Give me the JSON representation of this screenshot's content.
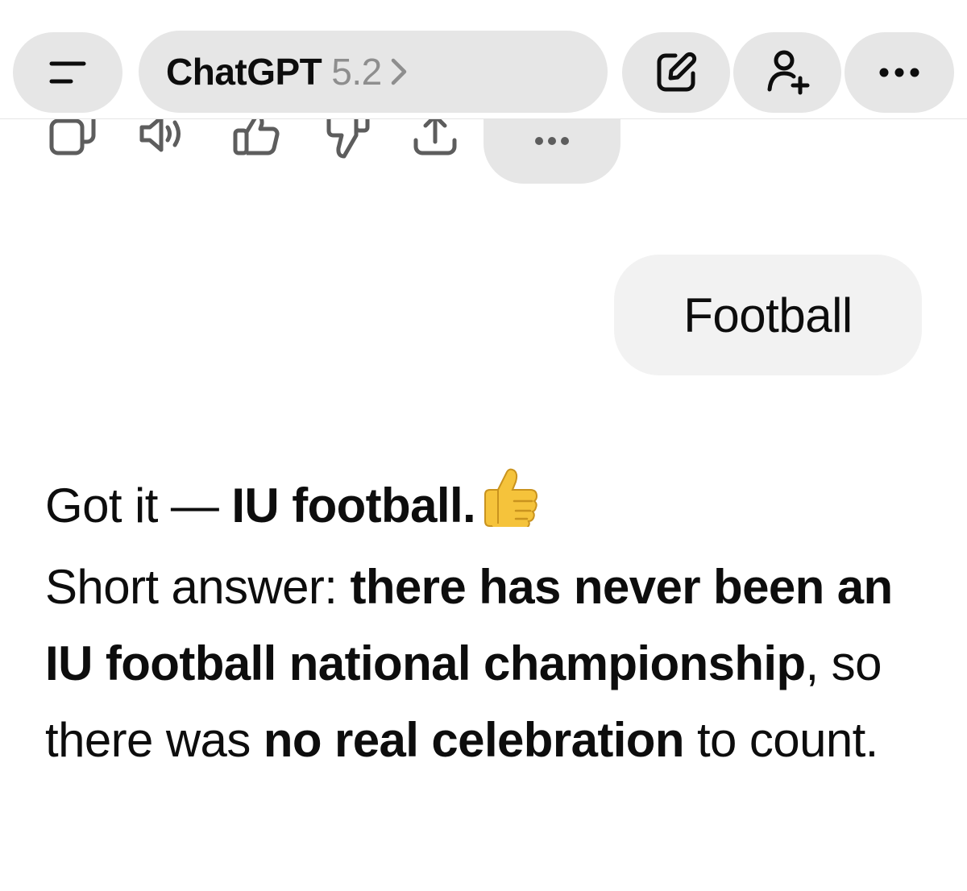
{
  "header": {
    "model_name": "ChatGPT",
    "model_version": "5.2",
    "icons": [
      "menu-icon",
      "chevron-right-icon",
      "edit-icon",
      "add-person-icon",
      "ellipsis-icon"
    ]
  },
  "message_actions": {
    "icons": [
      "copy-icon",
      "speaker-icon",
      "thumbs-up-icon",
      "thumbs-down-icon",
      "share-icon",
      "ellipsis-icon"
    ]
  },
  "conversation": {
    "user_message": "Football",
    "assistant": {
      "line1_normal": "Got it — ",
      "line1_bold": "IU football.",
      "line1_emoji": "thumbs-up-emoji",
      "line2_normal": "Short answer: ",
      "line2_bold": "there has never been an IU football national championship",
      "line2_rest": ", so there was ",
      "line3_bold": "no real celebration",
      "line3_rest": " to count."
    }
  },
  "colors": {
    "pill_bg": "#e6e6e6",
    "bubble_bg": "#f2f2f2",
    "text": "#0d0d0d",
    "muted": "#8e8e8e",
    "icon": "#5d5d5d",
    "emoji": "#f5c33b"
  }
}
